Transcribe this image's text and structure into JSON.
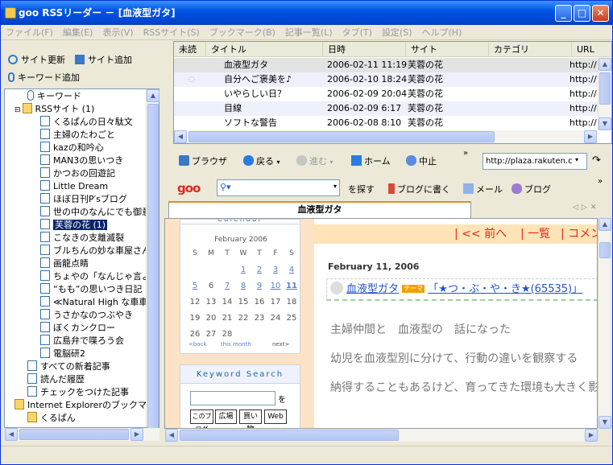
{
  "window": {
    "title": "goo RSSリーダー － [血液型ガタ]"
  },
  "menu": [
    "ファイル(F)",
    "編集(E)",
    "表示(V)",
    "RSSサイト(S)",
    "ブックマーク(B)",
    "記事一覧(L)",
    "タブ(T)",
    "設定(S)",
    "ヘルプ(H)"
  ],
  "left_toolbar": {
    "site_update": "サイト更新",
    "site_add": "サイト追加",
    "keyword_add": "キーワード追加"
  },
  "tree": {
    "keyword": "キーワード",
    "rss_sites": "RSSサイト (1)",
    "sites": [
      "くるぱんの日々駄文",
      "主婦のたわごと",
      "kazの和吟心",
      "MAN3の思いつき",
      "かつおの回遊記",
      "Little Dream",
      "ほぼ日刊P′sブログ",
      "世の中のなんにでも御意",
      "芙蓉の花 (1)",
      "こなきの支離滅裂",
      "ブルちんの妙な車屋さん",
      "画龍点睛",
      "ちょやの「なんじゃ言よんん",
      "“もも”の思いつき日記",
      "≪Natural High な車車",
      "うさかなのつぶやき",
      "ぼくカンクロー",
      "広島弁で喋ろう会",
      "電脳研2"
    ],
    "all_new": "すべての新着記事",
    "read_history": "読んだ履歴",
    "checked": "チェックをつけた記事",
    "ie_bookmarks": "Internet Explorerのブックマー",
    "kurupan": "くるぱん"
  },
  "list": {
    "headers": [
      "未読",
      "タイトル",
      "日時",
      "サイト",
      "カテゴリ",
      "URL"
    ],
    "rows": [
      {
        "title": "血液型ガタ",
        "date": "2006-02-11  11:19",
        "site": "芙蓉の花",
        "url": "http://"
      },
      {
        "title": "自分へご褒美を♪",
        "date": "2006-02-10  18:24",
        "site": "芙蓉の花",
        "url": "http://"
      },
      {
        "title": "いやらしい日？",
        "date": "2006-02-09  20:04",
        "site": "芙蓉の花",
        "url": "http://"
      },
      {
        "title": "目線",
        "date": "2006-02-09    6:17",
        "site": "芙蓉の花",
        "url": "http://"
      },
      {
        "title": "ソフトな警告",
        "date": "2006-02-08    8:10",
        "site": "芙蓉の花",
        "url": "http://"
      }
    ]
  },
  "browser_toolbar": {
    "browser": "ブラウザ",
    "back": "戻る",
    "forward": "進む",
    "home": "ホーム",
    "stop": "中止",
    "url": "http://plaza.rakuten.c"
  },
  "goo_toolbar": {
    "logo": "goo",
    "search": "を探す",
    "blog_write": "ブログに書く",
    "mail": "メール",
    "blog": "ブログ"
  },
  "tab": {
    "label": "血液型ガタ"
  },
  "page": {
    "calendar_title": "Calendar",
    "month": "February 2006",
    "weekdays": [
      "S",
      "M",
      "T",
      "W",
      "T",
      "F",
      "S"
    ],
    "days": [
      "1",
      "2",
      "3",
      "4",
      "5",
      "6",
      "7",
      "8",
      "9",
      "10",
      "11",
      "12",
      "13",
      "14",
      "15",
      "16",
      "17",
      "18",
      "19",
      "20",
      "21",
      "22",
      "23",
      "24",
      "25",
      "26",
      "27",
      "28"
    ],
    "cal_back": "<back",
    "cal_this": "this month",
    "cal_next": "next>",
    "keyword_search": "Keyword Search",
    "wo": "を",
    "search_buttons": [
      "このブログ",
      "広場",
      "買い物",
      "Web"
    ],
    "nav_prev": "| << 前へ",
    "nav_list": "| 一覧",
    "nav_comment": "| コメン",
    "date": "February 11, 2006",
    "entry_title": "血液型ガタ",
    "entry_tag": "テーマ",
    "entry_blog": "「★つ・ぶ・や・き★(65535)」",
    "body1": "主婦仲間と　血液型の　話になった",
    "body2": "幼児を血液型別に分けて、行動の違いを観察する",
    "body3": "納得することもあるけど、育ってきた環境も大きく影"
  }
}
